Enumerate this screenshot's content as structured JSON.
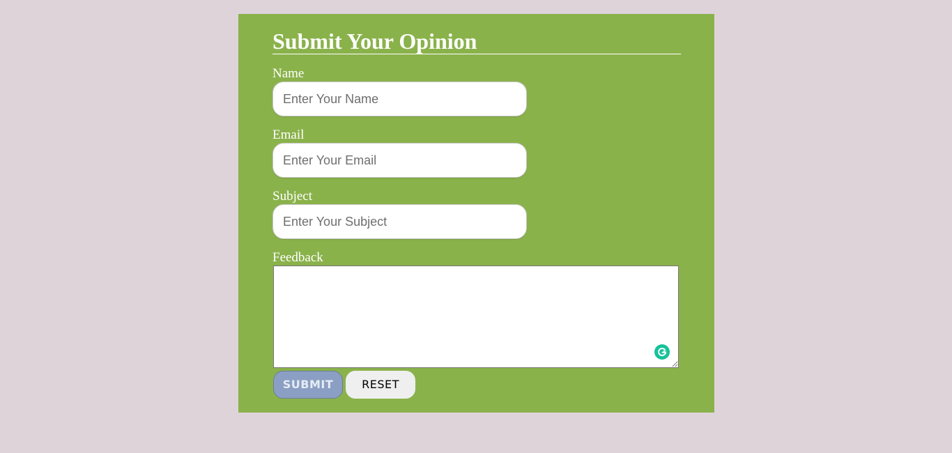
{
  "page": {
    "background_color": "#dfd3da",
    "panel_color": "#8ab24b"
  },
  "form": {
    "title": "Submit Your Opinion",
    "fields": {
      "name": {
        "label": "Name",
        "placeholder": "Enter Your Name",
        "value": ""
      },
      "email": {
        "label": "Email",
        "placeholder": "Enter Your Email",
        "value": ""
      },
      "subject": {
        "label": "Subject",
        "placeholder": "Enter Your Subject",
        "value": ""
      },
      "feedback": {
        "label": "Feedback",
        "value": ""
      }
    },
    "buttons": {
      "submit_label": "SUBMIT",
      "reset_label": "RESET",
      "submit_color": "#8b9fc4",
      "reset_color": "#efefef"
    },
    "icons": {
      "grammarly": "grammarly-icon",
      "grammarly_color": "#15c39a"
    }
  }
}
